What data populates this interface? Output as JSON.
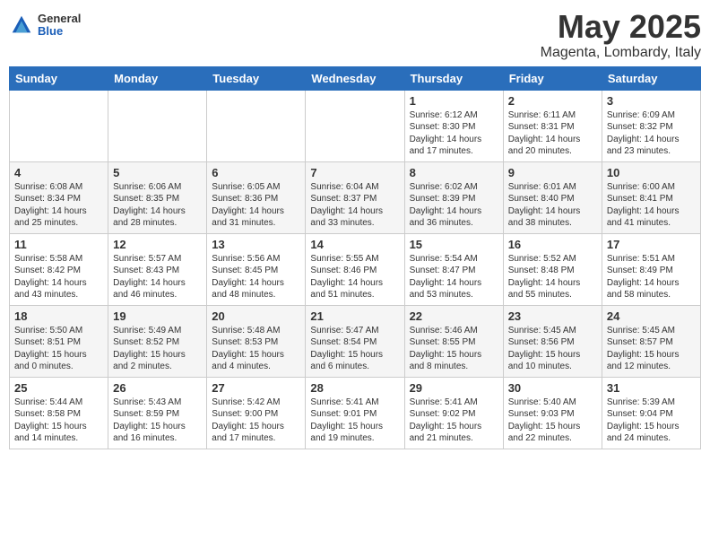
{
  "logo": {
    "general": "General",
    "blue": "Blue"
  },
  "title": "May 2025",
  "location": "Magenta, Lombardy, Italy",
  "days_of_week": [
    "Sunday",
    "Monday",
    "Tuesday",
    "Wednesday",
    "Thursday",
    "Friday",
    "Saturday"
  ],
  "weeks": [
    [
      {
        "day": "",
        "info": ""
      },
      {
        "day": "",
        "info": ""
      },
      {
        "day": "",
        "info": ""
      },
      {
        "day": "",
        "info": ""
      },
      {
        "day": "1",
        "info": "Sunrise: 6:12 AM\nSunset: 8:30 PM\nDaylight: 14 hours\nand 17 minutes."
      },
      {
        "day": "2",
        "info": "Sunrise: 6:11 AM\nSunset: 8:31 PM\nDaylight: 14 hours\nand 20 minutes."
      },
      {
        "day": "3",
        "info": "Sunrise: 6:09 AM\nSunset: 8:32 PM\nDaylight: 14 hours\nand 23 minutes."
      }
    ],
    [
      {
        "day": "4",
        "info": "Sunrise: 6:08 AM\nSunset: 8:34 PM\nDaylight: 14 hours\nand 25 minutes."
      },
      {
        "day": "5",
        "info": "Sunrise: 6:06 AM\nSunset: 8:35 PM\nDaylight: 14 hours\nand 28 minutes."
      },
      {
        "day": "6",
        "info": "Sunrise: 6:05 AM\nSunset: 8:36 PM\nDaylight: 14 hours\nand 31 minutes."
      },
      {
        "day": "7",
        "info": "Sunrise: 6:04 AM\nSunset: 8:37 PM\nDaylight: 14 hours\nand 33 minutes."
      },
      {
        "day": "8",
        "info": "Sunrise: 6:02 AM\nSunset: 8:39 PM\nDaylight: 14 hours\nand 36 minutes."
      },
      {
        "day": "9",
        "info": "Sunrise: 6:01 AM\nSunset: 8:40 PM\nDaylight: 14 hours\nand 38 minutes."
      },
      {
        "day": "10",
        "info": "Sunrise: 6:00 AM\nSunset: 8:41 PM\nDaylight: 14 hours\nand 41 minutes."
      }
    ],
    [
      {
        "day": "11",
        "info": "Sunrise: 5:58 AM\nSunset: 8:42 PM\nDaylight: 14 hours\nand 43 minutes."
      },
      {
        "day": "12",
        "info": "Sunrise: 5:57 AM\nSunset: 8:43 PM\nDaylight: 14 hours\nand 46 minutes."
      },
      {
        "day": "13",
        "info": "Sunrise: 5:56 AM\nSunset: 8:45 PM\nDaylight: 14 hours\nand 48 minutes."
      },
      {
        "day": "14",
        "info": "Sunrise: 5:55 AM\nSunset: 8:46 PM\nDaylight: 14 hours\nand 51 minutes."
      },
      {
        "day": "15",
        "info": "Sunrise: 5:54 AM\nSunset: 8:47 PM\nDaylight: 14 hours\nand 53 minutes."
      },
      {
        "day": "16",
        "info": "Sunrise: 5:52 AM\nSunset: 8:48 PM\nDaylight: 14 hours\nand 55 minutes."
      },
      {
        "day": "17",
        "info": "Sunrise: 5:51 AM\nSunset: 8:49 PM\nDaylight: 14 hours\nand 58 minutes."
      }
    ],
    [
      {
        "day": "18",
        "info": "Sunrise: 5:50 AM\nSunset: 8:51 PM\nDaylight: 15 hours\nand 0 minutes."
      },
      {
        "day": "19",
        "info": "Sunrise: 5:49 AM\nSunset: 8:52 PM\nDaylight: 15 hours\nand 2 minutes."
      },
      {
        "day": "20",
        "info": "Sunrise: 5:48 AM\nSunset: 8:53 PM\nDaylight: 15 hours\nand 4 minutes."
      },
      {
        "day": "21",
        "info": "Sunrise: 5:47 AM\nSunset: 8:54 PM\nDaylight: 15 hours\nand 6 minutes."
      },
      {
        "day": "22",
        "info": "Sunrise: 5:46 AM\nSunset: 8:55 PM\nDaylight: 15 hours\nand 8 minutes."
      },
      {
        "day": "23",
        "info": "Sunrise: 5:45 AM\nSunset: 8:56 PM\nDaylight: 15 hours\nand 10 minutes."
      },
      {
        "day": "24",
        "info": "Sunrise: 5:45 AM\nSunset: 8:57 PM\nDaylight: 15 hours\nand 12 minutes."
      }
    ],
    [
      {
        "day": "25",
        "info": "Sunrise: 5:44 AM\nSunset: 8:58 PM\nDaylight: 15 hours\nand 14 minutes."
      },
      {
        "day": "26",
        "info": "Sunrise: 5:43 AM\nSunset: 8:59 PM\nDaylight: 15 hours\nand 16 minutes."
      },
      {
        "day": "27",
        "info": "Sunrise: 5:42 AM\nSunset: 9:00 PM\nDaylight: 15 hours\nand 17 minutes."
      },
      {
        "day": "28",
        "info": "Sunrise: 5:41 AM\nSunset: 9:01 PM\nDaylight: 15 hours\nand 19 minutes."
      },
      {
        "day": "29",
        "info": "Sunrise: 5:41 AM\nSunset: 9:02 PM\nDaylight: 15 hours\nand 21 minutes."
      },
      {
        "day": "30",
        "info": "Sunrise: 5:40 AM\nSunset: 9:03 PM\nDaylight: 15 hours\nand 22 minutes."
      },
      {
        "day": "31",
        "info": "Sunrise: 5:39 AM\nSunset: 9:04 PM\nDaylight: 15 hours\nand 24 minutes."
      }
    ]
  ]
}
